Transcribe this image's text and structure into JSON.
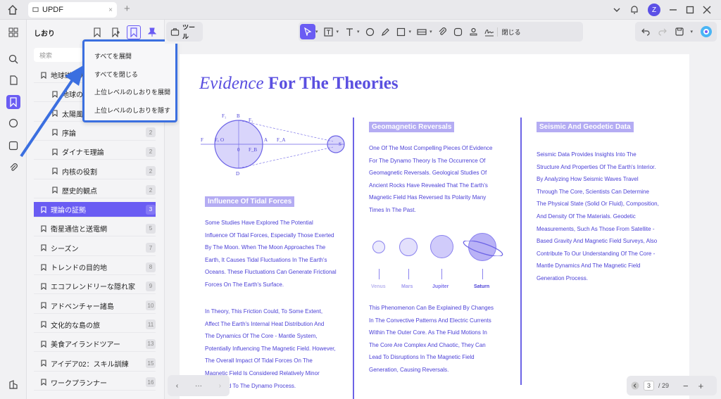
{
  "tabbar": {
    "tab_title": "UPDF",
    "tab_close": "×",
    "new_tab": "+",
    "avatar": "Z"
  },
  "panel": {
    "title": "しおり",
    "search_placeholder": "検索",
    "bookmarks": [
      {
        "label": "地球磁場の役割",
        "count": "",
        "level": 0,
        "active": false
      },
      {
        "label": "地球の磁場",
        "count": "",
        "level": 1,
        "active": false
      },
      {
        "label": "太陽風",
        "count": "",
        "level": 1,
        "active": false
      },
      {
        "label": "序論",
        "count": "2",
        "level": 1,
        "active": false
      },
      {
        "label": "ダイナモ理論",
        "count": "2",
        "level": 1,
        "active": false
      },
      {
        "label": "内核の役割",
        "count": "2",
        "level": 1,
        "active": false
      },
      {
        "label": "歴史的観点",
        "count": "2",
        "level": 1,
        "active": false
      },
      {
        "label": "理論の証拠",
        "count": "3",
        "level": 0,
        "active": true
      },
      {
        "label": "衛星通信と送電網",
        "count": "5",
        "level": 0,
        "active": false
      },
      {
        "label": "シーズン",
        "count": "7",
        "level": 0,
        "active": false
      },
      {
        "label": "トレンドの目的地",
        "count": "8",
        "level": 0,
        "active": false
      },
      {
        "label": "エコフレンドリーな隠れ家",
        "count": "9",
        "level": 0,
        "active": false
      },
      {
        "label": "アドベンチャー諸島",
        "count": "10",
        "level": 0,
        "active": false
      },
      {
        "label": "文化的な島の旅",
        "count": "11",
        "level": 0,
        "active": false
      },
      {
        "label": "美食アイランドツアー",
        "count": "13",
        "level": 0,
        "active": false
      },
      {
        "label": "アイデア02：スキル訓練",
        "count": "15",
        "level": 0,
        "active": false
      },
      {
        "label": "ワークプランナー",
        "count": "16",
        "level": 0,
        "active": false
      }
    ]
  },
  "dropdown": {
    "items": [
      "すべてを展開",
      "すべてを閉じる",
      "上位レベルのしおりを展開",
      "上位レベルのしおりを隠す"
    ]
  },
  "toolbar": {
    "tools_label": "ツール",
    "close_label": "閉じる"
  },
  "document": {
    "title_italic": "Evidence",
    "title_bold": "For The Theories",
    "col1": {
      "heading": "Influence Of Tidal Forces",
      "para1": [
        "Some Studies Have Explored The Potential",
        "Influence Of Tidal Forces, Especially Those Exerted",
        "By The Moon. When The Moon Approaches The",
        "Earth, It Causes Tidal Fluctuations In The Earth's",
        "Oceans. These Fluctuations Can Generate Frictional",
        "Forces On The Earth's Surface."
      ],
      "para2": [
        " In Theory, This Friction Could, To Some Extent,",
        "Affect The Earth's Internal Heat Distribution And",
        "The Dynamics Of The Core - Mantle System,",
        "Potentially Influencing The Magnetic Field. However,",
        "The Overall Impact Of Tidal Forces On The",
        "Magnetic Field Is Considered Relatively Minor",
        "Compared To The Dynamo Process."
      ]
    },
    "col2": {
      "heading": "Geomagnetic Reversals",
      "para1": [
        "One Of The Most Compelling Pieces Of Evidence",
        "For The Dynamo Theory Is The Occurrence Of",
        "Geomagnetic Reversals. Geological Studies Of",
        "Ancient Rocks Have Revealed That The Earth's",
        "Magnetic Field Has Reversed Its Polarity Many",
        "Times In The Past."
      ],
      "planets": [
        "Venus",
        "Mars",
        "Jupiter",
        "Saturn"
      ],
      "para2": [
        "This Phenomenon Can Be Explained By Changes",
        "In The Convective Patterns And Electric Currents",
        "Within The Outer Core. As The Fluid Motions In",
        "The Core Are Complex And Chaotic, They Can",
        "Lead To Disruptions In The Magnetic Field",
        "Generation, Causing Reversals."
      ]
    },
    "col3": {
      "heading": "Seismic And Geodetic Data",
      "para1": [
        "Seismic Data Provides Insights Into The",
        "Structure And Properties Of The Earth's Interior.",
        "By Analyzing How Seismic Waves Travel",
        "Through The Core, Scientists Can Determine",
        "The Physical State (Solid Or Fluid), Composition,",
        "And Density Of The Materials. Geodetic",
        "Measurements, Such As Those From Satellite -",
        "Based Gravity And Magnetic Field Surveys, Also",
        "Contribute To Our Understanding Of The Core -",
        "Mantle Dynamics And The Magnetic Field",
        "Generation Process."
      ]
    },
    "diagram_labels": {
      "f1": "F₁",
      "b": "B",
      "f2": "F₂",
      "f": "F",
      "fe": "Fₑ",
      "o": "O",
      "zero": "0",
      "fb": "F_B",
      "a": "A",
      "fa": "F_A",
      "d": "D",
      "s": "S"
    }
  },
  "pagenav": {
    "prev": "‹",
    "dots": "···",
    "next": "›"
  },
  "zoom": {
    "current_page": "3",
    "total": "/ 29",
    "minus": "−",
    "plus": "+"
  }
}
